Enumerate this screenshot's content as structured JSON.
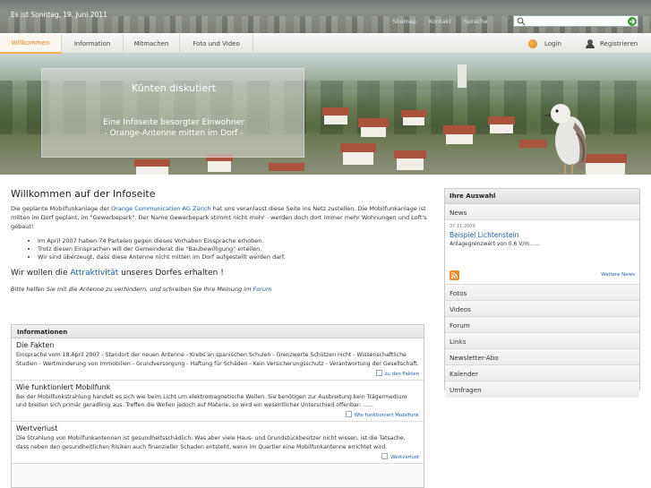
{
  "topbar": {
    "date": "Es ist Sonntag, 19. Juni 2011",
    "links": [
      "Sitemap",
      "Kontakt",
      "Sprache"
    ],
    "search_placeholder": ""
  },
  "nav": {
    "tabs": [
      {
        "label": "Willkommen",
        "active": true
      },
      {
        "label": "Information",
        "active": false
      },
      {
        "label": "Mitmachen",
        "active": false
      },
      {
        "label": "Foto und Video",
        "active": false
      }
    ],
    "login": "Login",
    "register": "Registrieren"
  },
  "hero": {
    "title": "Künten diskutiert",
    "sub1": "Eine Infoseite besorgter Einwohner",
    "sub2": "- Orange-Antenne mitten im Dorf -"
  },
  "main": {
    "title": "Willkommen auf der Infoseite",
    "intro_a": "Die geplante Mobilfunkanlage der ",
    "intro_link": "Orange Communication AG Zürich",
    "intro_b": " hat uns veranlasst diese Seite ins Netz zustellen.  Die Mobilfunkanlage ist mitten im Dorf geplant, im \"Gewerbepark\". Der Name Gewerbepark stimmt nicht mehr - werden doch dort immer mehr Wohnungen und Loft's gebaut!",
    "bullets": [
      "Im April 2007 haben 74 Parteien gegen dieses Vorhaben Einsprache erhoben.",
      "Trotz diesen Einsprachen will der Gemeinderat die \"Baubewilligung\" erteilen.",
      "Wir sind überzeugt, dass diese Antenne nicht mitten im Dorf aufgestellt werden darf."
    ],
    "slogan_a": "Wir wollen die ",
    "slogan_link": "Attraktivität",
    "slogan_b": " unseres Dorfes erhalten !",
    "request_a": "Bitte helfen Sie mit die Antenne zu verhindern, und schreiben Sie Ihre Meinung im ",
    "request_link": "Forum"
  },
  "info": {
    "header": "Informationen",
    "items": [
      {
        "title": "Die Fakten",
        "text": "Einsprache vom 18.April 2007 - Standort der neuen Antenne - Krebs an spanischen Schulen - Grenzwerte Schützen nicht - Wissenschaftliche Studien - Wertminderung von Immobilien - Grundversorgung - Haftung für Schäden - Kein Versicherungsschutz - Verantwortung der Gesellschaft.",
        "more": "zu den Fakten"
      },
      {
        "title": "Wie funktioniert Mobilfunk",
        "text": "Bei der Mobilfunkstrahlung handelt es sich wie beim Licht um elektromagnetische Wellen. Sie benötigen zur Ausbreitung kein Trägermedium und breiten sich primär geradlinig aus. Treffen die Wellen jedoch auf Materie, so wird ein wesentlicher Unterschied offenbar: ......",
        "more": "Wie funktioniert Mobilfunk"
      },
      {
        "title": "Wertverlust",
        "text": "Die Strahlung von Mobilfunkantennen ist gesundheitsschädlich. Was aber viele Haus- und Grundstückbesitzer nicht wissen, ist die Tatsache, dass neben den gesundheitlichen Risiken auch finanzieller Schaden entsteht, wenn im Quartier eine Mobilfunkantenne errichtet wird.",
        "more": "Wertverlust"
      }
    ]
  },
  "sidebar": {
    "header": "Ihre Auswahl",
    "news_label": "News",
    "news": {
      "date": "07.11.2009",
      "title": "Beispiel Lichtenstein",
      "text": "Anlagegrenzwert von 0.6 V/m......",
      "more": "Weitere News"
    },
    "items": [
      "Fotos",
      "Videos",
      "Forum",
      "Links",
      "Newsletter-Abo",
      "Kalender",
      "Umfragen"
    ]
  }
}
